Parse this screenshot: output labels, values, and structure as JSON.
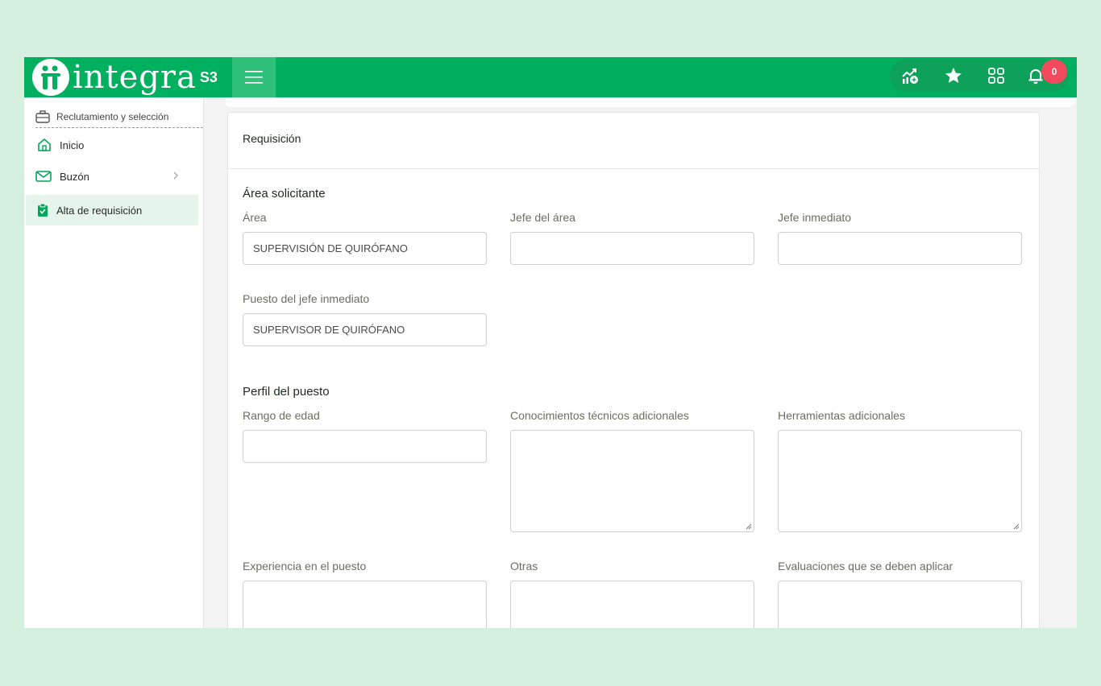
{
  "header": {
    "logo_text": "integra",
    "logo_mark": "S3",
    "notification_count": "0",
    "icons": [
      "dashboard-growth-icon",
      "star-icon",
      "apps-grid-icon",
      "bell-icon"
    ],
    "colors": {
      "brand": "#00b05e",
      "badge": "#f2495c"
    }
  },
  "sidebar": {
    "module_title": "Reclutamiento y selección",
    "items": [
      {
        "label": "Inicio",
        "icon": "home-icon",
        "active": false
      },
      {
        "label": "Buzón",
        "icon": "mail-icon",
        "active": false
      },
      {
        "label": "Alta de requisición",
        "icon": "clipboard-check-icon",
        "active": true
      }
    ]
  },
  "form": {
    "title": "Requisición",
    "area_section": {
      "title": "Área solicitante",
      "area_label": "Área",
      "area_value": "SUPERVISIÓN DE QUIRÓFANO",
      "jefe_area_label": "Jefe del área",
      "jefe_area_value": "",
      "jefe_inmediato_label": "Jefe inmediato",
      "jefe_inmediato_value": "",
      "puesto_jefe_label": "Puesto del jefe inmediato",
      "puesto_jefe_value": "SUPERVISOR DE QUIRÓFANO"
    },
    "perfil_section": {
      "title": "Perfil del puesto",
      "rango_label": "Rango de edad",
      "rango_value": "",
      "conocimientos_label": "Conocimientos técnicos adicionales",
      "herramientas_label": "Herramientas adicionales",
      "experiencia_label": "Experiencia en el puesto",
      "otras_label": "Otras",
      "evaluaciones_label": "Evaluaciones que se deben aplicar"
    }
  }
}
